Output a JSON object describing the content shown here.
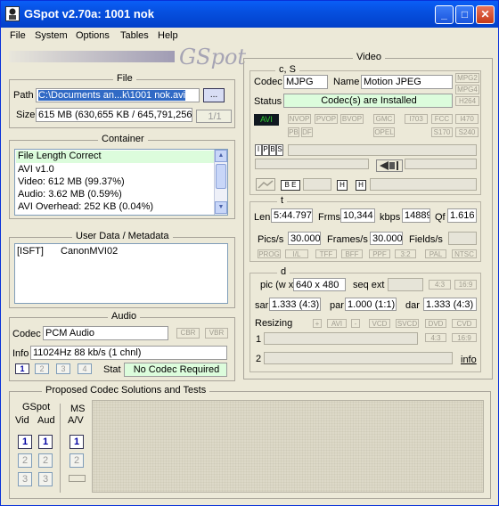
{
  "window": {
    "title": "GSpot v2.70a: 1001 nok",
    "minimize": "_",
    "maximize": "□",
    "close": "✕"
  },
  "menu": [
    "File",
    "System",
    "Options",
    "Tables",
    "Help"
  ],
  "logo": "GSpot",
  "file": {
    "title": "File",
    "path_label": "Path",
    "path_value": "C:\\Documents an...k\\1001 nok.avi",
    "browse_label": "...",
    "size_label": "Size",
    "size_value": "615 MB (630,655 KB / 645,791,256",
    "part_value": "1/1"
  },
  "container": {
    "title": "Container",
    "items": [
      "File Length Correct",
      "AVI v1.0",
      "Video: 612 MB (99.37%)",
      "Audio: 3.62 MB (0.59%)",
      "AVI Overhead: 252 KB (0.04%)"
    ]
  },
  "metadata": {
    "title": "User Data / Metadata",
    "tag": "[ISFT]",
    "value": "CanonMVI02"
  },
  "audio": {
    "title": "Audio",
    "codec_label": "Codec",
    "codec_value": "PCM Audio",
    "cbr": "CBR",
    "vbr": "VBR",
    "info_label": "Info",
    "info_value": "11024Hz  88 kb/s (1 chnl)",
    "tracks": [
      "1",
      "2",
      "3",
      "4"
    ],
    "stat_label": "Stat",
    "stat_value": "No Codec Required"
  },
  "proposed": {
    "title": "Proposed Codec Solutions and Tests",
    "gspot_label": "GSpot",
    "vid_label": "Vid",
    "aud_label": "Aud",
    "ms_label": "MS",
    "av_label": "A/V",
    "vid_btns": [
      "1",
      "2",
      "3"
    ],
    "aud_btns": [
      "1",
      "2",
      "3"
    ],
    "ms_btns": [
      "1",
      "2"
    ]
  },
  "video": {
    "title": "Video",
    "cs_label": "c, S",
    "codec_label": "Codec",
    "codec_value": "MJPG",
    "name_label": "Name",
    "name_value": "Motion JPEG",
    "status_label": "Status",
    "status_value": "Codec(s) are Installed",
    "side_tags": [
      "MPG2",
      "MPG4",
      "H264"
    ],
    "avi_badge": "AVI",
    "flags_row1": [
      "NVOP",
      "PVOP",
      "BVOP",
      "GMC",
      "I703",
      "FCC",
      "I470"
    ],
    "flags_row2": [
      "PB",
      "DF",
      "OPEL",
      "S170",
      "S240"
    ],
    "frame_tags": [
      "I",
      "P",
      "B",
      "S"
    ],
    "be_label": "B E",
    "h_label": "H",
    "h2_label": "H",
    "t_label": "t",
    "len_label": "Len",
    "len_value": "5:44.797",
    "frms_label": "Frms",
    "frms_value": "10,344",
    "kbps_label": "kbps",
    "kbps_value": "14889",
    "qf_label": "Qf",
    "qf_value": "1.616",
    "pics_label": "Pics/s",
    "pics_value": "30.000",
    "frames_label": "Frames/s",
    "frames_value": "30.000",
    "fields_label": "Fields/s",
    "fields_value": "",
    "rate_tags": [
      "PROG",
      "I/L",
      "TFF",
      "BFF",
      "PPF",
      "3:2",
      "PAL",
      "NTSC"
    ],
    "d_label": "d",
    "pic_label": "pic (w x",
    "pic_value": "640 x 480",
    "seqext_label": "seq ext",
    "ar_tags": [
      "4:3",
      "16:9"
    ],
    "sar_label": "sar",
    "sar_value": "1.333 (4:3)",
    "par_label": "par",
    "par_value": "1.000 (1:1)",
    "dar_label": "dar",
    "dar_value": "1.333 (4:3)",
    "resizing_label": "Resizing",
    "resize_tags": [
      "+",
      "AVI",
      "-",
      "VCD",
      "SVCD",
      "DVD",
      "CVD"
    ],
    "row1_label": "1",
    "row2_label": "2",
    "resize_ar": [
      "4:3",
      "16:9"
    ],
    "info_link": "info"
  },
  "colors": {
    "title_bar": "#0650e0",
    "window_bg": "#ece9d8",
    "status_green": "#dcfcdc",
    "selected_text_bg": "#316ac5",
    "accent_blue": "#0000a0"
  }
}
